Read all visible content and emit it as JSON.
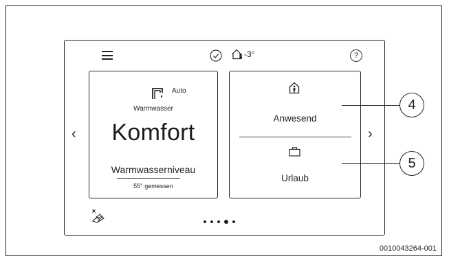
{
  "status_bar": {
    "outdoor_temperature": "-3°"
  },
  "hot_water_tile": {
    "mode_label": "Auto",
    "title": "Warmwasser",
    "level": "Komfort",
    "subtitle": "Warmwasserniveau",
    "measured": "55° gemessen"
  },
  "presence_tile": {
    "present_label": "Anwesend",
    "holiday_label": "Urlaub"
  },
  "callouts": {
    "c4": "4",
    "c5": "5"
  },
  "pager": {
    "count": 5,
    "active_index": 3
  },
  "caption": "0010043264-001",
  "icons": [
    "menu-icon",
    "checkmark-circle-icon",
    "house-thermometer-icon",
    "help-icon",
    "hot-water-tap-icon",
    "home-person-icon",
    "suitcase-icon",
    "solar-panel-icon",
    "chevron-left-icon",
    "chevron-right-icon"
  ]
}
